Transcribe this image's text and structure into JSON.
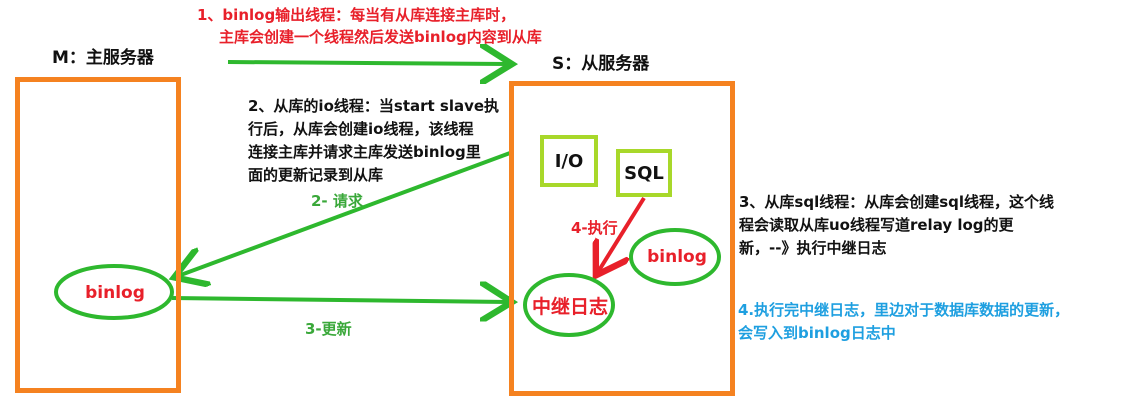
{
  "notes": {
    "note1_line1": "1、binlog输出线程：每当有从库连接主库时，",
    "note1_line2": "主库会创建一个线程然后发送binlog内容到从库",
    "note2_line1": "2、从库的io线程：当start slave执",
    "note2_line2": "行后，从库会创建io线程，该线程",
    "note2_line3": "连接主库并请求主库发送binlog里",
    "note2_line4": "面的更新记录到从库",
    "note3_line1": "3、从库sql线程：从库会创建sql线程，这个线",
    "note3_line2": "程会读取从库uo线程写道relay log的更",
    "note3_line3": "新，--》执行中继日志",
    "note4_line1": "4.执行完中继日志，里边对于数据库数据的更新，",
    "note4_line2": "会写入到binlog日志中"
  },
  "labels": {
    "master": "M：主服务器",
    "slave": "S：从服务器",
    "master_binlog": "binlog",
    "slave_binlog": "binlog",
    "relay_log": "中继日志",
    "io": "I/O",
    "sql": "SQL",
    "request": "2- 请求",
    "update": "3-更新",
    "execute": "4-执行"
  },
  "colors": {
    "server_box": "#f58220",
    "thread_box": "#a8d82a",
    "arrow_green": "#2eb82e",
    "arrow_red": "#e8202a",
    "text_red": "#e8202a",
    "text_blue": "#1e9fe0"
  }
}
